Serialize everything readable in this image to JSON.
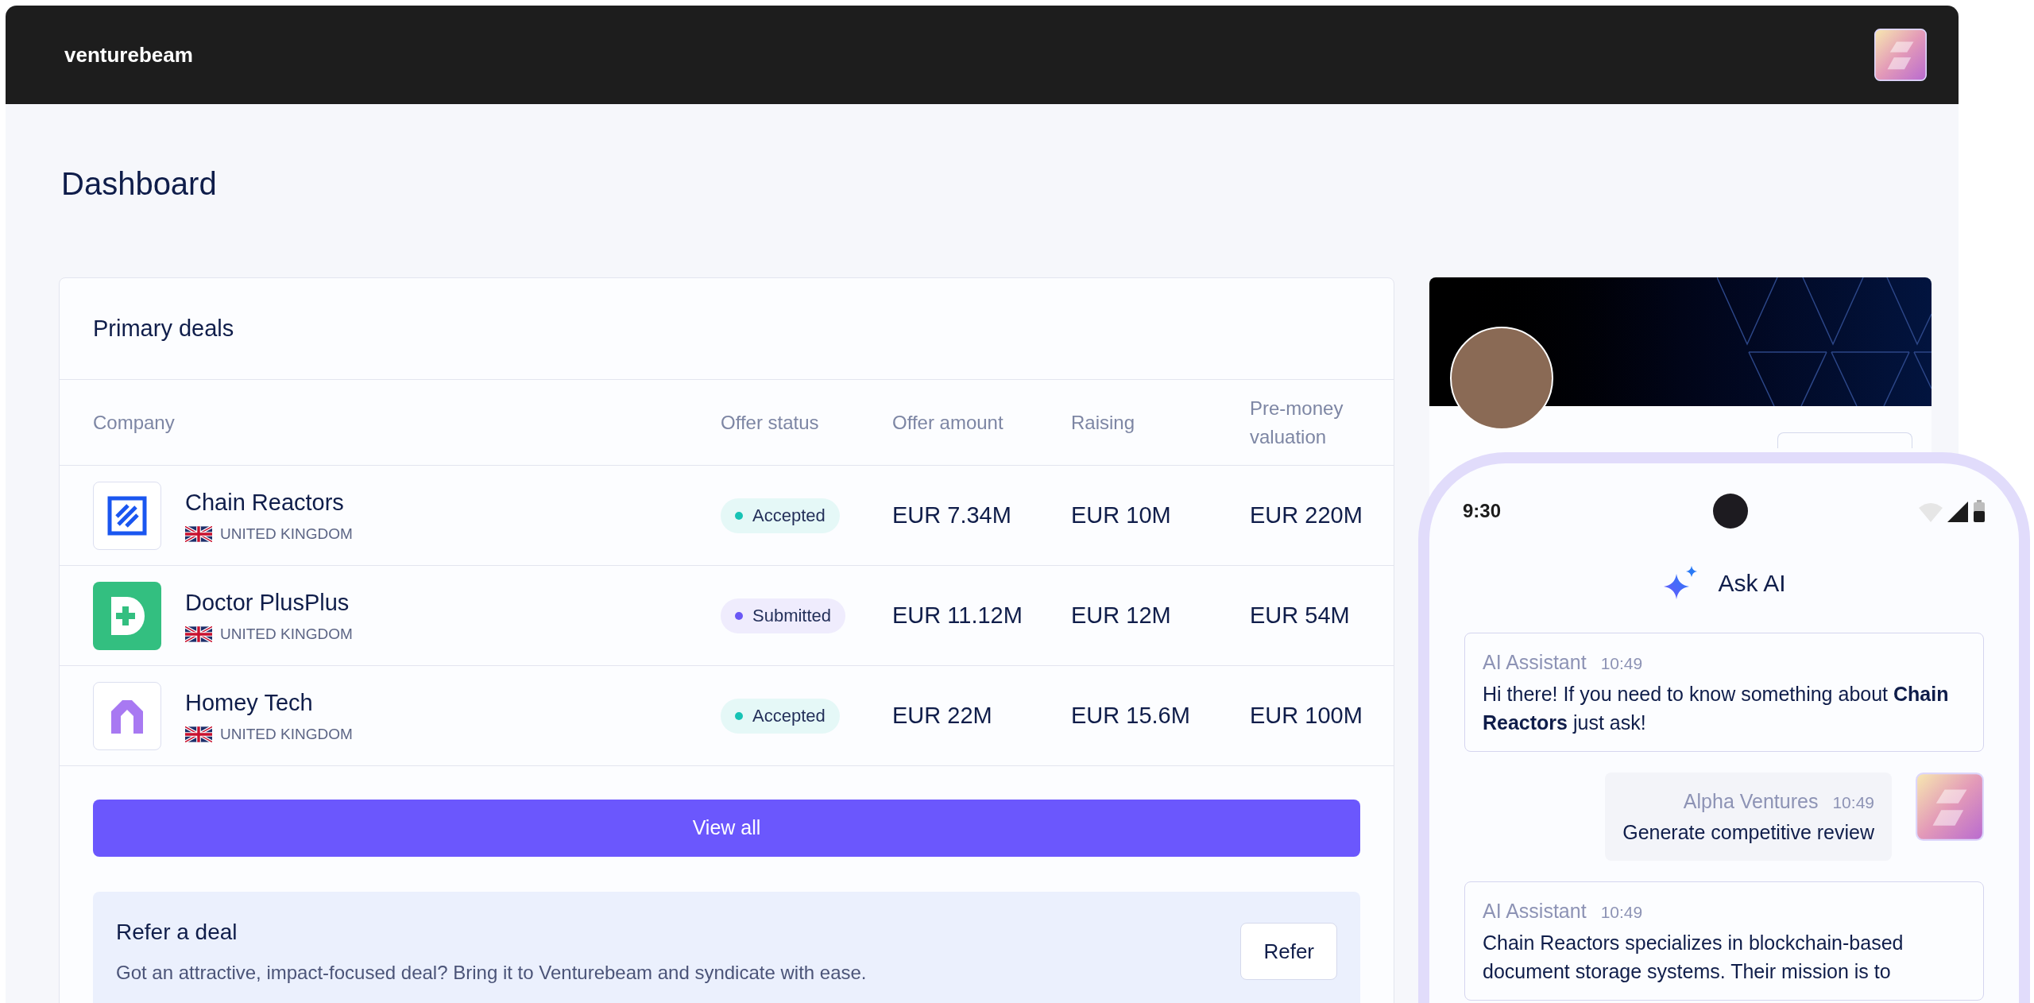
{
  "topbar": {
    "brand": "venturebeam"
  },
  "page": {
    "title": "Dashboard"
  },
  "deals": {
    "title": "Primary deals",
    "columns": [
      "Company",
      "Offer status",
      "Offer amount",
      "Raising",
      "Pre-money valuation"
    ],
    "rows": [
      {
        "company": "Chain Reactors",
        "country": "UNITED KINGDOM",
        "logo": {
          "kind": "chain"
        },
        "status": {
          "label": "Accepted",
          "kind": "accepted"
        },
        "offer": "EUR 7.34M",
        "raising": "EUR 10M",
        "valuation": "EUR 220M"
      },
      {
        "company": "Doctor PlusPlus",
        "country": "UNITED KINGDOM",
        "logo": {
          "kind": "doctor"
        },
        "status": {
          "label": "Submitted",
          "kind": "submitted"
        },
        "offer": "EUR 11.12M",
        "raising": "EUR 12M",
        "valuation": "EUR 54M"
      },
      {
        "company": "Homey Tech",
        "country": "UNITED KINGDOM",
        "logo": {
          "kind": "homey"
        },
        "status": {
          "label": "Accepted",
          "kind": "accepted"
        },
        "offer": "EUR 22M",
        "raising": "EUR 15.6M",
        "valuation": "EUR 100M"
      }
    ],
    "view_all": "View all"
  },
  "refer": {
    "title": "Refer a deal",
    "text": "Got an attractive, impact-focused deal? Bring it to Venturebeam and syndicate with ease.",
    "button": "Refer"
  },
  "phone": {
    "time": "9:30",
    "title": "Ask AI",
    "messages": [
      {
        "kind": "assistant",
        "sender": "AI Assistant",
        "time": "10:49",
        "text": "Hi there! If you need to know something about **Chain Reactors** just ask!"
      },
      {
        "kind": "user",
        "sender": "Alpha Ventures",
        "time": "10:49",
        "text": "Generate competitive review"
      },
      {
        "kind": "assistant",
        "sender": "AI Assistant",
        "time": "10:49",
        "text": "Chain Reactors specializes in blockchain-based document storage systems. Their mission is to"
      }
    ]
  }
}
